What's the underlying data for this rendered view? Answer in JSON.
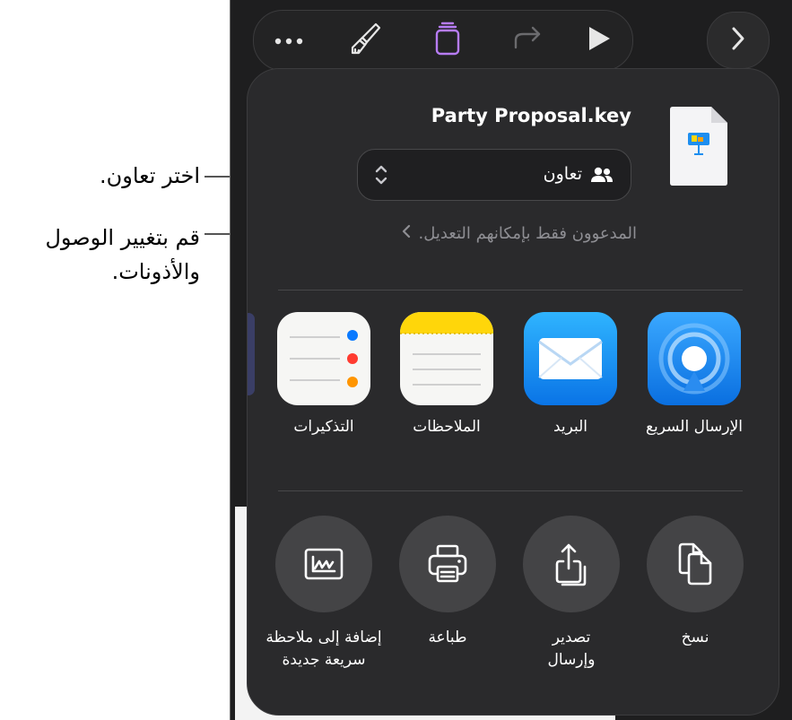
{
  "callouts": {
    "choose_collaborate": "اختر تعاون.",
    "change_access_line1": "قم بتغيير الوصول",
    "change_access_line2": "والأذونات."
  },
  "toolbar": {
    "more_icon": "more-icon",
    "format_icon": "paintbrush-icon",
    "document_icon": "document-icon",
    "redo_icon": "redo-icon",
    "play_icon": "play-icon",
    "next_icon": "chevron-right-icon"
  },
  "share_sheet": {
    "file_name": "Party Proposal.key",
    "collaboration": {
      "label": "تعاون",
      "access_summary": "المدعوون فقط بإمكانهم التعديل."
    },
    "apps": [
      {
        "label": "الإرسال السريع",
        "icon": "airdrop-icon"
      },
      {
        "label": "البريد",
        "icon": "mail-icon"
      },
      {
        "label": "الملاحظات",
        "icon": "notes-icon"
      },
      {
        "label": "التذكيرات",
        "icon": "reminders-icon"
      }
    ],
    "actions": [
      {
        "label": "نسخ",
        "icon": "copy-icon"
      },
      {
        "label": "تصدير\nوإرسال",
        "icon": "export-icon"
      },
      {
        "label": "طباعة",
        "icon": "printer-icon"
      },
      {
        "label": "إضافة إلى ملاحظة\nسريعة جديدة",
        "icon": "quick-note-icon"
      }
    ]
  },
  "colors": {
    "accent_purple": "#b77cf7",
    "keynote_blue": "#1d8ef0",
    "notes_yellow": "#ffd60a"
  }
}
